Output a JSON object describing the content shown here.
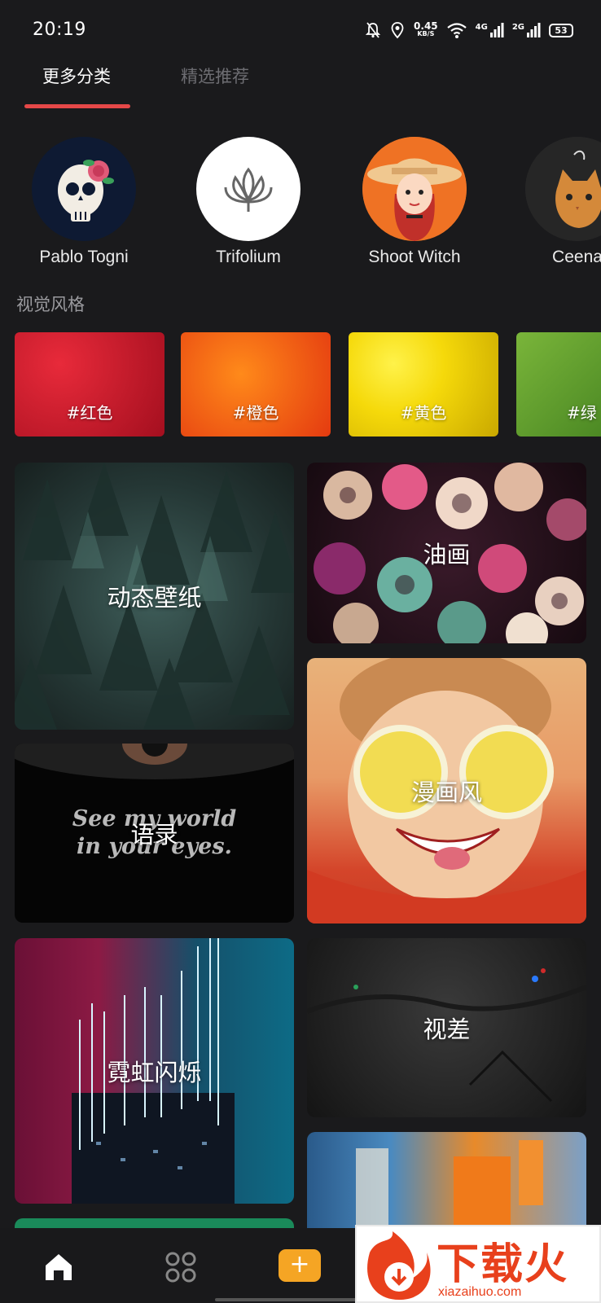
{
  "status_bar": {
    "time": "20:19",
    "speed_value": "0.45",
    "speed_unit": "KB/S",
    "net1": "4G",
    "net2": "2G",
    "battery": "53"
  },
  "tabs": [
    {
      "label": "更多分类",
      "active": true
    },
    {
      "label": "精选推荐",
      "active": false
    }
  ],
  "creators": [
    {
      "name": "Pablo Togni",
      "icon": "skull-rose-icon"
    },
    {
      "name": "Trifolium",
      "icon": "lotus-icon"
    },
    {
      "name": "Shoot Witch",
      "icon": "girl-hat-icon"
    },
    {
      "name": "Ceena",
      "icon": "cat-icon"
    }
  ],
  "visual_style": {
    "title": "视觉风格",
    "tags": [
      {
        "label": "#红色",
        "color": "#c8102e"
      },
      {
        "label": "#橙色",
        "color": "#f06014"
      },
      {
        "label": "#黄色",
        "color": "#f5d90a"
      },
      {
        "label": "#绿",
        "color": "#5a9a2a"
      }
    ]
  },
  "categories": {
    "left": [
      {
        "label": "动态壁纸",
        "overlay_text": ""
      },
      {
        "label": "语录",
        "overlay_text_1": "See my world",
        "overlay_text_2": "in your eyes."
      },
      {
        "label": "霓虹闪烁"
      }
    ],
    "right": [
      {
        "label": "油画"
      },
      {
        "label": "漫画风"
      },
      {
        "label": "视差"
      },
      {
        "label": ""
      }
    ]
  },
  "bottom_nav": {
    "add_label": "+"
  },
  "watermark": {
    "text": "下载火",
    "domain": "xiazaihuo.com"
  },
  "colors": {
    "accent": "#e54848",
    "add_button": "#f5a524",
    "background": "#1a1a1c"
  }
}
